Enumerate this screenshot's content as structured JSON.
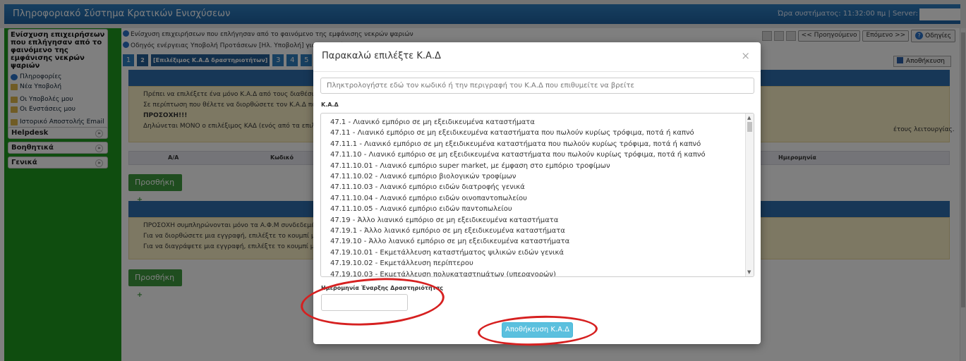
{
  "header": {
    "app_title": "Πληροφοριακό Σύστημα Κρατικών Ενισχύσεων",
    "system_time": "Ώρα συστήματος: 11:32:00 πμ | Server:"
  },
  "sidebar": {
    "panel_title": "Ενίσχυση επιχειρήσεων που επλήγησαν από το φαινόμενο της εμφάνισης νεκρών ψαριών",
    "links": [
      {
        "label": "Πληροφορίες",
        "icon": "info-icon"
      },
      {
        "label": "Νέα Υποβολή",
        "icon": "folder-icon"
      },
      {
        "label": "Οι Υποβολές μου",
        "icon": "folder-icon"
      },
      {
        "label": "Οι Ενστάσεις μου",
        "icon": "folder-icon"
      },
      {
        "label": "Ιστορικό Αποστολής Email",
        "icon": "folder-icon"
      }
    ],
    "sections": [
      "Helpdesk",
      "Βοηθητικά",
      "Γενικά"
    ]
  },
  "main": {
    "breadcrumb": "Ενίσχυση επιχειρήσεων που επλήγησαν από το φαινόμενο της εμφάνισης νεκρών ψαριών",
    "guide": "Οδηγός ενέργειας Υποβολή Προτάσεων [Ηλ. Υποβολή] για την πρόταση μ",
    "nav": {
      "prev": "<< Προηγούμενο",
      "next": "Επόμενο >>",
      "help": "Οδηγίες"
    },
    "steps": [
      "1",
      "2",
      "[Επιλέξιμος Κ.Α.Δ δραστηριοτήτων]",
      "3",
      "4",
      "5",
      "6"
    ],
    "save": "Αποθήκευση",
    "notice1": {
      "items": [
        "Πρέπει να επιλέξετε ένα μόνο Κ.Α.Δ από τους διαθέσιμους",
        "Σε περίπτωση που θέλετε να διορθώσετε τον Κ.Α.Δ που επ",
        "ΠΡΟΣΟΧΗ!!!",
        "Δηλώνεται ΜΟΝΟ ο επιλέξιμος ΚΑΔ (ενός από τα επιλέξιμα"
      ],
      "right_tail": "έτους λειτουργίας."
    },
    "table": {
      "col_aa": "Α/Α",
      "col_code": "Κωδικό",
      "col_date": "Ημερομηνία"
    },
    "add_button": "Προσθήκη",
    "notice2": {
      "items": [
        "ΠΡΟΣΟΧΗ συμπληρώνονται μόνο τα Α.Φ.Μ συνδεδεμένω",
        "Για να διορθώσετε μια εγγραφή, επιλέξτε το κουμπί με το ει",
        "Για να διαγράψετε μια εγγραφή, επιλέξτε το κουμπί με το ει"
      ]
    }
  },
  "modal": {
    "title": "Παρακαλώ επιλέξτε Κ.Α.Δ",
    "close": "×",
    "search_placeholder": "Πληκτρολογήστε εδώ τον κωδικό ή την περιγραφή του Κ.Α.Δ που επιθυμείτε να βρείτε",
    "kad_label": "Κ.Α.Δ",
    "kad_options": [
      "47.1 - Λιανικό εμπόριο σε μη εξειδικευμένα καταστήματα",
      "47.11 - Λιανικό εμπόριο σε μη εξειδικευμένα καταστήματα που πωλούν κυρίως τρόφιμα, ποτά ή καπνό",
      "47.11.1 - Λιανικό εμπόριο σε μη εξειδικευμένα καταστήματα που πωλούν κυρίως τρόφιμα, ποτά ή καπνό",
      "47.11.10 - Λιανικό εμπόριο σε μη εξειδικευμένα καταστήματα που πωλούν κυρίως τρόφιμα, ποτά ή καπνό",
      "47.11.10.01 - Λιανικό εμπόριο super market, με έμφαση στο εμπόριο τροφίμων",
      "47.11.10.02 - Λιανικό εμπόριο βιολογικών τροφίμων",
      "47.11.10.03 - Λιανικό εμπόριο ειδών διατροφής γενικά",
      "47.11.10.04 - Λιανικό εμπόριο ειδών οινοπαντοπωλείου",
      "47.11.10.05 - Λιανικό εμπόριο ειδών παντοπωλείου",
      "47.19 - Άλλο λιανικό εμπόριο σε μη εξειδικευμένα καταστήματα",
      "47.19.1 - Άλλο λιανικό εμπόριο σε μη εξειδικευμένα καταστήματα",
      "47.19.10 - Άλλο λιανικό εμπόριο σε μη εξειδικευμένα καταστήματα",
      "47.19.10.01 - Εκμετάλλευση καταστήματος ψιλικών ειδών γενικά",
      "47.19.10.02 - Εκμετάλλευση περίπτερου",
      "47.19.10.03 - Εκμετάλλευση πολυκαταστημάτων (υπεραγορών)"
    ],
    "start_date_label": "Ημερομηνία Έναρξης Δραστηριότητας",
    "start_date_value": "",
    "save_button": "Αποθήκευση Κ.Α.Δ"
  },
  "colors": {
    "header_blue": "#2f7fc1",
    "sidebar_green": "#1f9a1f",
    "save_button": "#5bc0de",
    "annotation_red": "#d62020"
  }
}
